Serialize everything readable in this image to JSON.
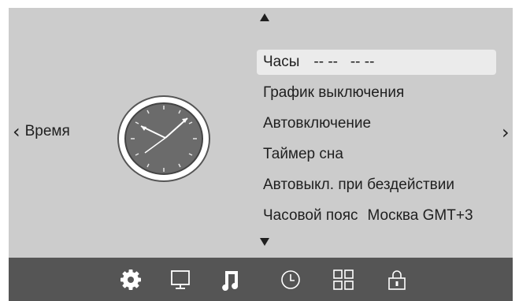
{
  "left_nav": {
    "label": "Время",
    "icon": "chevron-left-icon"
  },
  "right_nav": {
    "icon": "chevron-right-icon"
  },
  "scroll": {
    "up_icon": "triangle-up-icon",
    "down_icon": "triangle-down-icon"
  },
  "clock": {
    "icon": "analog-clock-icon"
  },
  "menu": {
    "items": [
      {
        "label": "Часы",
        "value": "-- --   -- --",
        "selected": true
      },
      {
        "label": "График выключения",
        "value": ""
      },
      {
        "label": "Автовключение",
        "value": ""
      },
      {
        "label": "Таймер сна",
        "value": ""
      },
      {
        "label": "Автовыкл. при бездействии",
        "value": ""
      },
      {
        "label": "Часовой пояс",
        "value": "Москва GMT+3"
      }
    ]
  },
  "bottom_bar": {
    "icons": [
      "settings-gear-icon",
      "monitor-icon",
      "music-note-icon",
      "clock-icon",
      "apps-grid-icon",
      "lock-icon"
    ],
    "active": "music-note-icon"
  },
  "colors": {
    "panel": "#cccccc",
    "bottom_bar": "#555555",
    "highlight": "#ebebeb",
    "clock_face": "#6b6b6b"
  }
}
